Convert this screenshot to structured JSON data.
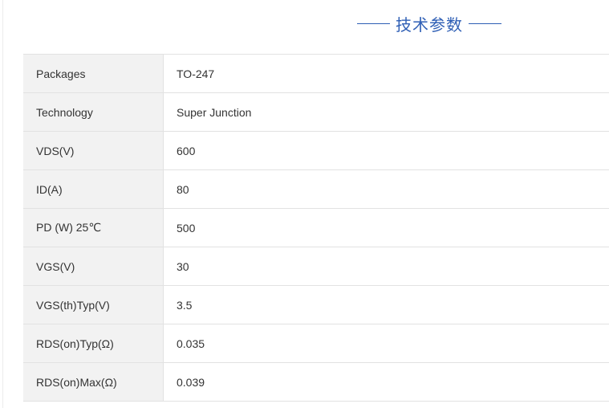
{
  "section": {
    "title": "技术参数"
  },
  "specs": [
    {
      "label": "Packages",
      "value": "TO-247"
    },
    {
      "label": "Technology",
      "value": "Super Junction"
    },
    {
      "label": "VDS(V)",
      "value": "600"
    },
    {
      "label": "ID(A)",
      "value": "80"
    },
    {
      "label": "PD (W) 25℃",
      "value": "500"
    },
    {
      "label": "VGS(V)",
      "value": "30"
    },
    {
      "label": "VGS(th)Typ(V)",
      "value": "3.5"
    },
    {
      "label": "RDS(on)Typ(Ω)",
      "value": "0.035"
    },
    {
      "label": "RDS(on)Max(Ω)",
      "value": "0.039"
    }
  ],
  "colors": {
    "title_accent": "#2f5fb5",
    "label_background": "#f2f2f2",
    "border": "#e2e2e2",
    "text": "#333333"
  }
}
